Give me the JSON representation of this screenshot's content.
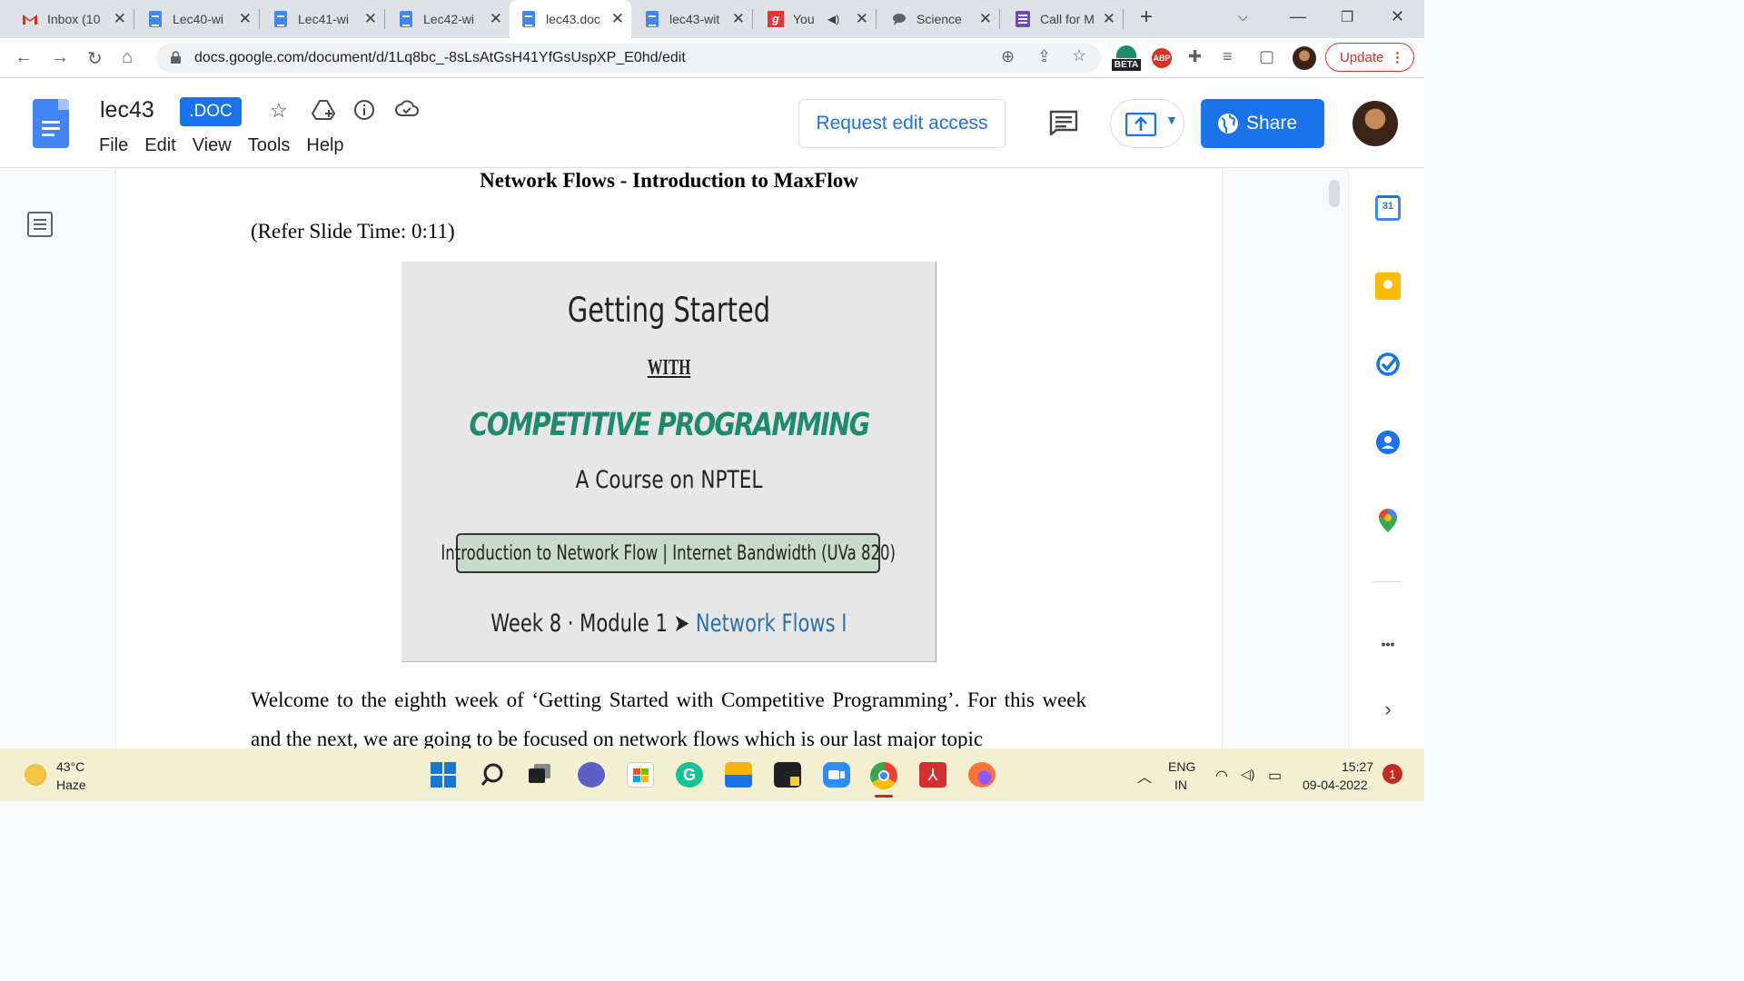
{
  "browser": {
    "tabs": [
      {
        "label": "Inbox (10",
        "icon": "gmail-icon"
      },
      {
        "label": "Lec40-wi",
        "icon": "docs-icon"
      },
      {
        "label": "Lec41-wi",
        "icon": "docs-icon"
      },
      {
        "label": "Lec42-wi",
        "icon": "docs-icon"
      },
      {
        "label": "lec43.doc",
        "icon": "docs-icon",
        "active": true
      },
      {
        "label": "lec43-wit",
        "icon": "docs-icon"
      },
      {
        "label": "You",
        "icon": "grammarly-icon"
      },
      {
        "label": "Science",
        "icon": "chat-icon"
      },
      {
        "label": "Call for M",
        "icon": "forms-icon"
      }
    ],
    "url": "docs.google.com/document/d/1Lq8bc_-8sLsAtGsH41YfGsUspXP_E0hd/edit",
    "beta_badge": "BETA",
    "abp_badge": "ABP",
    "update_label": "Update"
  },
  "docs": {
    "title": "lec43",
    "badge": ".DOC",
    "menu": [
      "File",
      "Edit",
      "View",
      "Tools",
      "Help"
    ],
    "request_edit": "Request edit access",
    "share": "Share"
  },
  "document": {
    "heading": "Network Flows - Introduction to MaxFlow",
    "refer": "(Refer Slide Time: 0:11)",
    "slide": {
      "title": "Getting Started",
      "with": "WITH",
      "cp": "COMPETITIVE PROGRAMMING",
      "course": "A Course on NPTEL",
      "box": "Introduction to Network Flow | Internet Bandwidth (UVa 820)",
      "week": "Week 8 · Module 1",
      "arrow": "➤",
      "nf": "Network Flows I"
    },
    "paragraph": "Welcome to the eighth week of ‘Getting Started with Competitive Programming’. For this week and the next, we are going to be focused on network flows which is our last major topic"
  },
  "sidepanel": {
    "calendar_day": "31",
    "more": "•••"
  },
  "taskbar": {
    "temp": "43°C",
    "weather": "Haze",
    "lang1": "ENG",
    "lang2": "IN",
    "time": "15:27",
    "date": "09-04-2022",
    "notifications": "1"
  },
  "colors": {
    "accent": "#1a73e8",
    "slide_green": "#1f8a6c",
    "update_red": "#d93025"
  }
}
